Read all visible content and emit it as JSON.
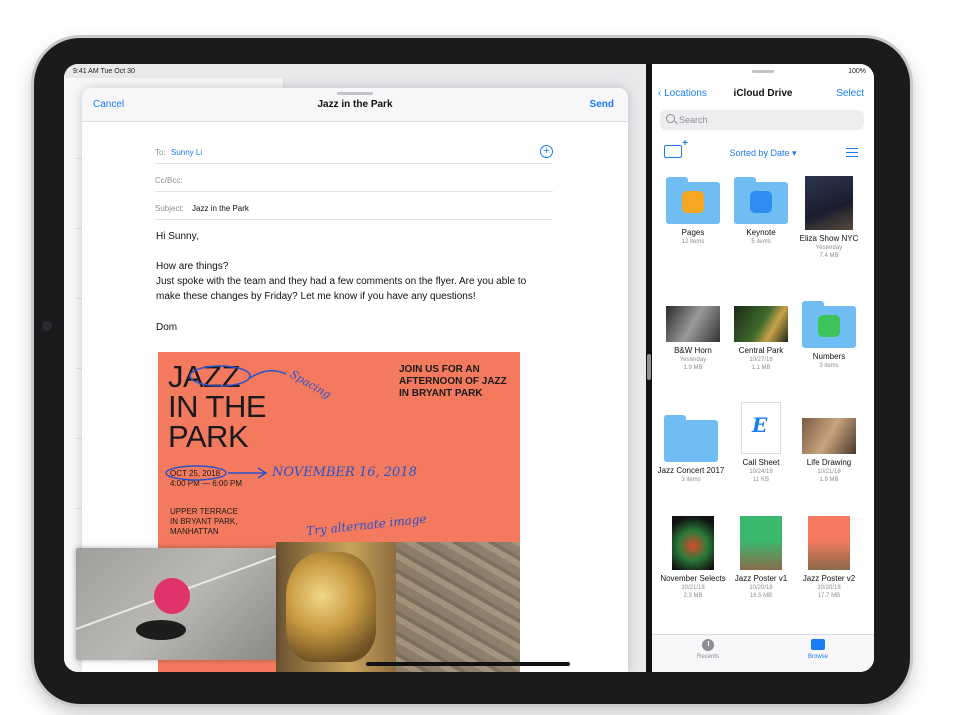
{
  "status_left": "9:41 AM  Tue Oct 30",
  "status_right": "100%",
  "compose": {
    "cancel": "Cancel",
    "title": "Jazz in the Park",
    "send": "Send",
    "to_label": "To:",
    "to_value": "Sunny Li",
    "ccbcc_label": "Cc/Bcc:",
    "subject_label": "Subject:",
    "subject_value": "Jazz in the Park",
    "greeting": "Hi Sunny,",
    "body_lines": [
      "How are things?",
      "Just spoke with the team and they had a few comments on the flyer. Are you able to",
      "make these changes by Friday? Let me know if you have any questions!"
    ],
    "signoff": "Dom"
  },
  "flyer": {
    "title_lines": [
      "JAZZ",
      "IN THE",
      "PARK"
    ],
    "join_lines": [
      "JOIN US FOR AN",
      "AFTERNOON OF JAZZ",
      "IN BRYANT PARK"
    ],
    "date": "OCT 25, 2018",
    "time": "4:00 PM — 6:00 PM",
    "place_lines": [
      "UPPER TERRACE",
      "IN BRYANT PARK,",
      "MANHATTAN"
    ],
    "note_spacing": "Spacing",
    "note_date": "NOVEMBER 16, 2018",
    "note_image": "Try alternate image"
  },
  "files": {
    "back": "Locations",
    "title": "iCloud Drive",
    "select": "Select",
    "search_placeholder": "Search",
    "sort": "Sorted by Date ▾",
    "items": [
      {
        "name": "Pages",
        "sub1": "12 items",
        "sub2": ""
      },
      {
        "name": "Keynote",
        "sub1": "5 items",
        "sub2": ""
      },
      {
        "name": "Eliza Show NYC",
        "sub1": "Yesterday",
        "sub2": "7.4 MB"
      },
      {
        "name": "B&W Horn",
        "sub1": "Yesterday",
        "sub2": "1.9 MB"
      },
      {
        "name": "Central Park",
        "sub1": "10/27/18",
        "sub2": "1.1 MB"
      },
      {
        "name": "Numbers",
        "sub1": "3 items",
        "sub2": ""
      },
      {
        "name": "Jazz Concert 2017",
        "sub1": "3 items",
        "sub2": ""
      },
      {
        "name": "Call Sheet",
        "sub1": "10/24/18",
        "sub2": "11 KB"
      },
      {
        "name": "Life Drawing",
        "sub1": "10/21/18",
        "sub2": "1.9 MB"
      },
      {
        "name": "November Selects",
        "sub1": "10/21/18",
        "sub2": "2.3 MB"
      },
      {
        "name": "Jazz Poster v1",
        "sub1": "10/20/18",
        "sub2": "18.5 MB"
      },
      {
        "name": "Jazz Poster v2",
        "sub1": "10/20/18",
        "sub2": "17.7 MB"
      }
    ],
    "tab_recents": "Recents",
    "tab_browse": "Browse"
  },
  "colors": {
    "accent": "#1a7cf5",
    "flyer": "#f47a5f",
    "folder": "#6fbdf3"
  }
}
